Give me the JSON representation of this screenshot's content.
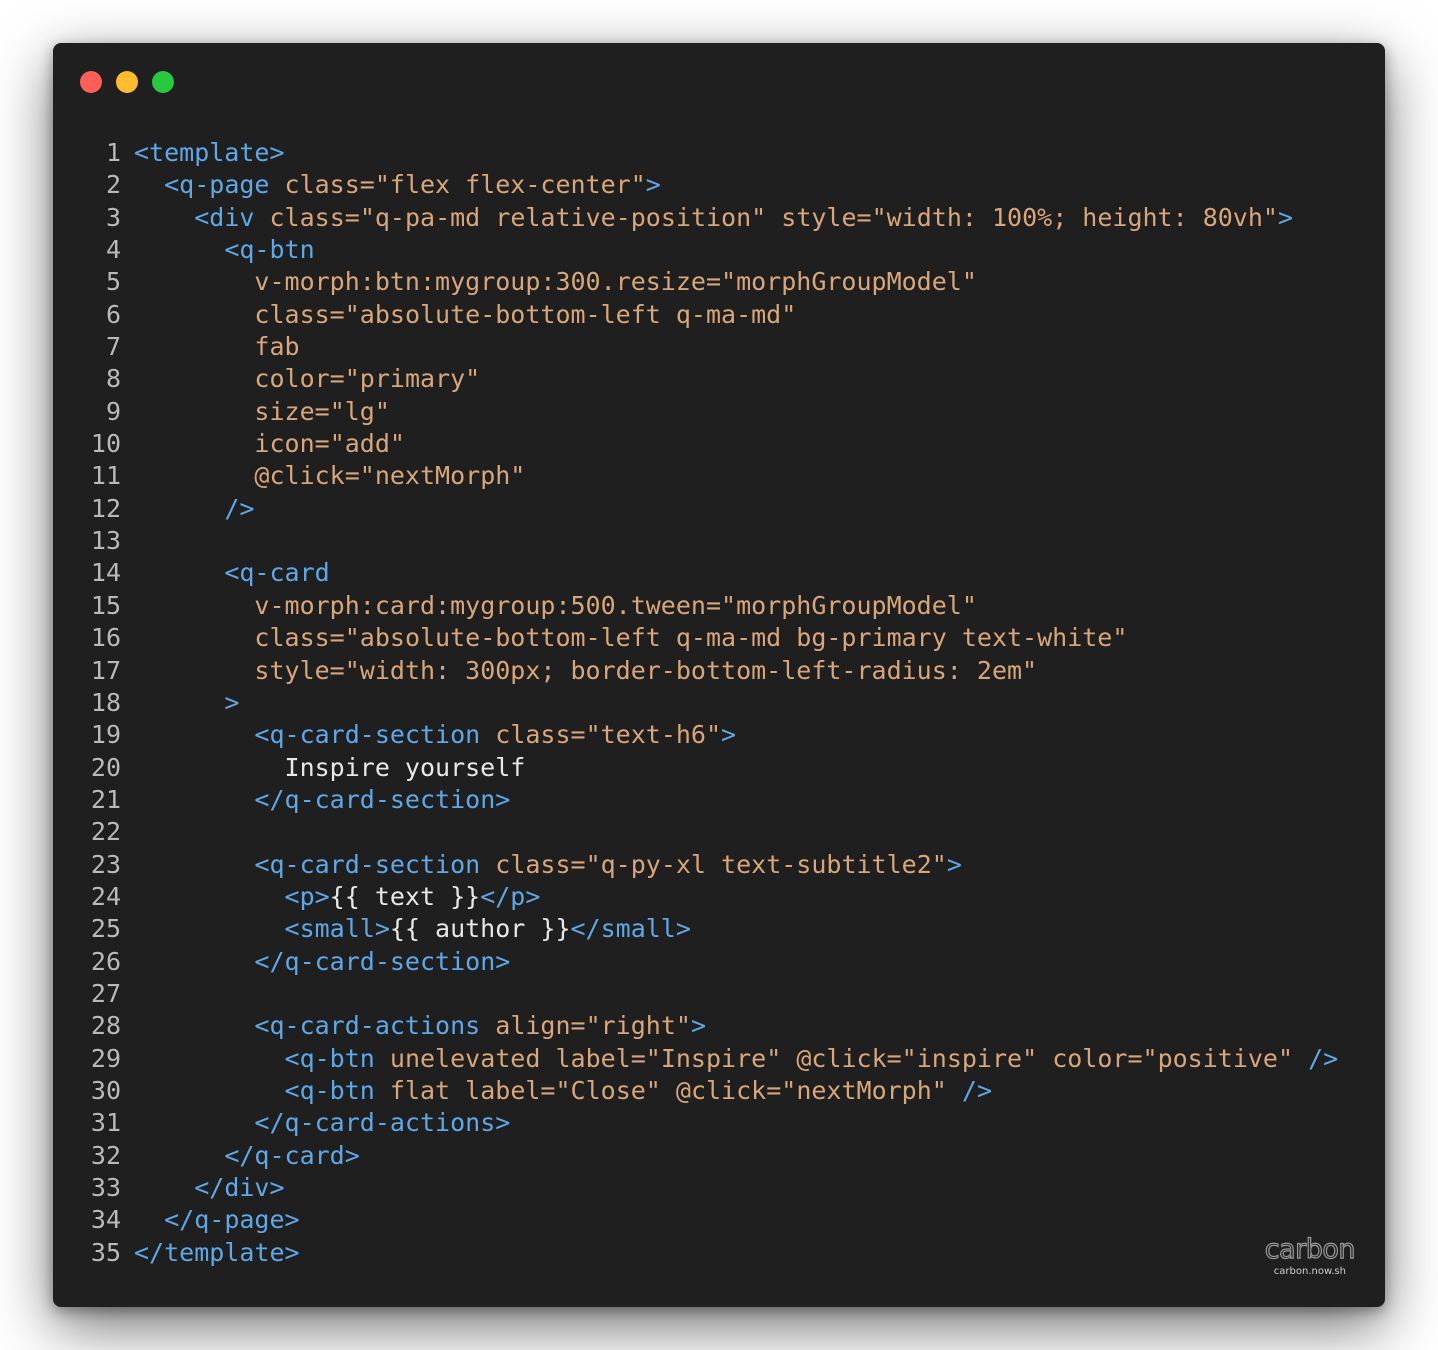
{
  "window": {
    "controls": {
      "close_color": "#ff5f57",
      "minimize_color": "#febc2e",
      "maximize_color": "#28c840"
    }
  },
  "code": {
    "lines": [
      [
        [
          "tag",
          "<template>"
        ]
      ],
      [
        [
          "ws",
          "  "
        ],
        [
          "tag",
          "<q-page"
        ],
        [
          "ws",
          " "
        ],
        [
          "attr",
          "class="
        ],
        [
          "str",
          "\"flex flex-center\""
        ],
        [
          "tag",
          ">"
        ]
      ],
      [
        [
          "ws",
          "    "
        ],
        [
          "tag",
          "<div"
        ],
        [
          "ws",
          " "
        ],
        [
          "attr",
          "class="
        ],
        [
          "str",
          "\"q-pa-md relative-position\""
        ],
        [
          "ws",
          " "
        ],
        [
          "attr",
          "style="
        ],
        [
          "str",
          "\"width: 100%; height: 80vh\""
        ],
        [
          "tag",
          ">"
        ]
      ],
      [
        [
          "ws",
          "      "
        ],
        [
          "tag",
          "<q-btn"
        ]
      ],
      [
        [
          "ws",
          "        "
        ],
        [
          "attr",
          "v-morph:btn:mygroup:300.resize="
        ],
        [
          "str",
          "\"morphGroupModel\""
        ]
      ],
      [
        [
          "ws",
          "        "
        ],
        [
          "attr",
          "class="
        ],
        [
          "str",
          "\"absolute-bottom-left q-ma-md\""
        ]
      ],
      [
        [
          "ws",
          "        "
        ],
        [
          "attr",
          "fab"
        ]
      ],
      [
        [
          "ws",
          "        "
        ],
        [
          "attr",
          "color="
        ],
        [
          "str",
          "\"primary\""
        ]
      ],
      [
        [
          "ws",
          "        "
        ],
        [
          "attr",
          "size="
        ],
        [
          "str",
          "\"lg\""
        ]
      ],
      [
        [
          "ws",
          "        "
        ],
        [
          "attr",
          "icon="
        ],
        [
          "str",
          "\"add\""
        ]
      ],
      [
        [
          "ws",
          "        "
        ],
        [
          "attr",
          "@click="
        ],
        [
          "str",
          "\"nextMorph\""
        ]
      ],
      [
        [
          "ws",
          "      "
        ],
        [
          "tag",
          "/>"
        ]
      ],
      [],
      [
        [
          "ws",
          "      "
        ],
        [
          "tag",
          "<q-card"
        ]
      ],
      [
        [
          "ws",
          "        "
        ],
        [
          "attr",
          "v-morph:card:mygroup:500.tween="
        ],
        [
          "str",
          "\"morphGroupModel\""
        ]
      ],
      [
        [
          "ws",
          "        "
        ],
        [
          "attr",
          "class="
        ],
        [
          "str",
          "\"absolute-bottom-left q-ma-md bg-primary text-white\""
        ]
      ],
      [
        [
          "ws",
          "        "
        ],
        [
          "attr",
          "style="
        ],
        [
          "str",
          "\"width: 300px; border-bottom-left-radius: 2em\""
        ]
      ],
      [
        [
          "ws",
          "      "
        ],
        [
          "tag",
          ">"
        ]
      ],
      [
        [
          "ws",
          "        "
        ],
        [
          "tag",
          "<q-card-section"
        ],
        [
          "ws",
          " "
        ],
        [
          "attr",
          "class="
        ],
        [
          "str",
          "\"text-h6\""
        ],
        [
          "tag",
          ">"
        ]
      ],
      [
        [
          "ws",
          "          "
        ],
        [
          "txt",
          "Inspire yourself"
        ]
      ],
      [
        [
          "ws",
          "        "
        ],
        [
          "tag",
          "</q-card-section>"
        ]
      ],
      [],
      [
        [
          "ws",
          "        "
        ],
        [
          "tag",
          "<q-card-section"
        ],
        [
          "ws",
          " "
        ],
        [
          "attr",
          "class="
        ],
        [
          "str",
          "\"q-py-xl text-subtitle2\""
        ],
        [
          "tag",
          ">"
        ]
      ],
      [
        [
          "ws",
          "          "
        ],
        [
          "tag",
          "<p>"
        ],
        [
          "txt",
          "{{ text }}"
        ],
        [
          "tag",
          "</p>"
        ]
      ],
      [
        [
          "ws",
          "          "
        ],
        [
          "tag",
          "<small>"
        ],
        [
          "txt",
          "{{ author }}"
        ],
        [
          "tag",
          "</small>"
        ]
      ],
      [
        [
          "ws",
          "        "
        ],
        [
          "tag",
          "</q-card-section>"
        ]
      ],
      [],
      [
        [
          "ws",
          "        "
        ],
        [
          "tag",
          "<q-card-actions"
        ],
        [
          "ws",
          " "
        ],
        [
          "attr",
          "align="
        ],
        [
          "str",
          "\"right\""
        ],
        [
          "tag",
          ">"
        ]
      ],
      [
        [
          "ws",
          "          "
        ],
        [
          "tag",
          "<q-btn"
        ],
        [
          "ws",
          " "
        ],
        [
          "attr",
          "unelevated"
        ],
        [
          "ws",
          " "
        ],
        [
          "attr",
          "label="
        ],
        [
          "str",
          "\"Inspire\""
        ],
        [
          "ws",
          " "
        ],
        [
          "attr",
          "@click="
        ],
        [
          "str",
          "\"inspire\""
        ],
        [
          "ws",
          " "
        ],
        [
          "attr",
          "color="
        ],
        [
          "str",
          "\"positive\""
        ],
        [
          "ws",
          " "
        ],
        [
          "tag",
          "/>"
        ]
      ],
      [
        [
          "ws",
          "          "
        ],
        [
          "tag",
          "<q-btn"
        ],
        [
          "ws",
          " "
        ],
        [
          "attr",
          "flat"
        ],
        [
          "ws",
          " "
        ],
        [
          "attr",
          "label="
        ],
        [
          "str",
          "\"Close\""
        ],
        [
          "ws",
          " "
        ],
        [
          "attr",
          "@click="
        ],
        [
          "str",
          "\"nextMorph\""
        ],
        [
          "ws",
          " "
        ],
        [
          "tag",
          "/>"
        ]
      ],
      [
        [
          "ws",
          "        "
        ],
        [
          "tag",
          "</q-card-actions>"
        ]
      ],
      [
        [
          "ws",
          "      "
        ],
        [
          "tag",
          "</q-card>"
        ]
      ],
      [
        [
          "ws",
          "    "
        ],
        [
          "tag",
          "</div>"
        ]
      ],
      [
        [
          "ws",
          "  "
        ],
        [
          "tag",
          "</q-page>"
        ]
      ],
      [
        [
          "tag",
          "</template>"
        ]
      ]
    ]
  },
  "watermark": {
    "logo": "carbon",
    "url": "carbon.now.sh"
  }
}
